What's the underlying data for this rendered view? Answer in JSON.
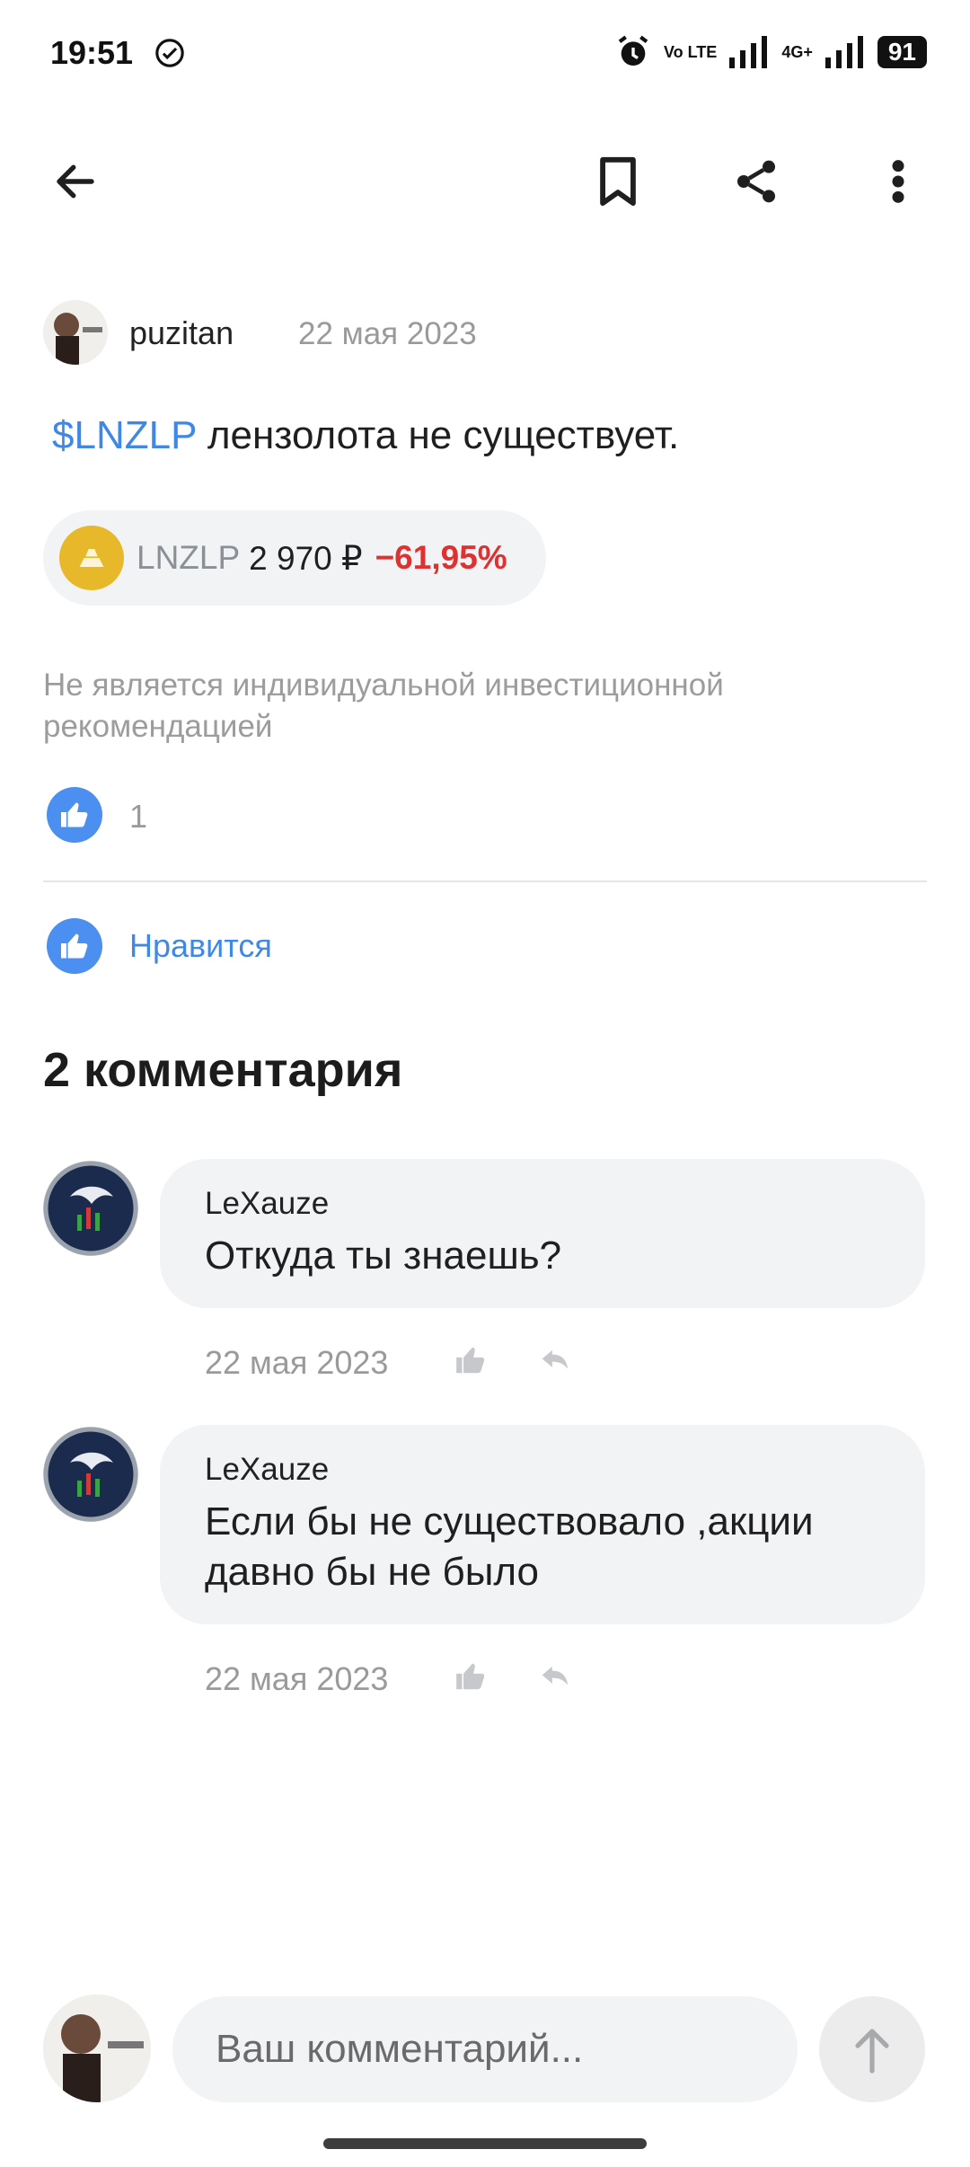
{
  "status_bar": {
    "time": "19:51",
    "network_label": "Vo LTE",
    "cellular_label": "4G+",
    "battery": "91",
    "icons": [
      "check-circle-icon",
      "alarm-icon",
      "signal-icon",
      "signal-icon"
    ]
  },
  "top_bar": {
    "icons": [
      "back-arrow-icon",
      "bookmark-icon",
      "share-icon",
      "more-vertical-icon"
    ]
  },
  "post": {
    "author": "puzitan",
    "date": "22 мая 2023",
    "ticker_link": "$LNZLP",
    "text": " лензолота не существует.",
    "chip": {
      "ticker": "LNZLP",
      "price": "2 970 ₽",
      "change": "−61,95%"
    },
    "disclaimer": "Не является индивидуальной инвестиционной рекомендацией",
    "likes_count": "1",
    "like_button_label": "Нравится"
  },
  "comments": {
    "title": "2 комментария",
    "items": [
      {
        "author": "LeXauze",
        "text": "Откуда ты знаешь?",
        "date": "22 мая 2023"
      },
      {
        "author": "LeXauze",
        "text": "Если бы не существовало ,акции давно бы не было",
        "date": "22 мая 2023"
      }
    ]
  },
  "composer": {
    "placeholder": "Ваш комментарий..."
  },
  "colors": {
    "accent": "#3f88e6",
    "negative": "#e03131",
    "chip_bg": "#f2f3f5",
    "like_blue": "#4b8ff0"
  }
}
